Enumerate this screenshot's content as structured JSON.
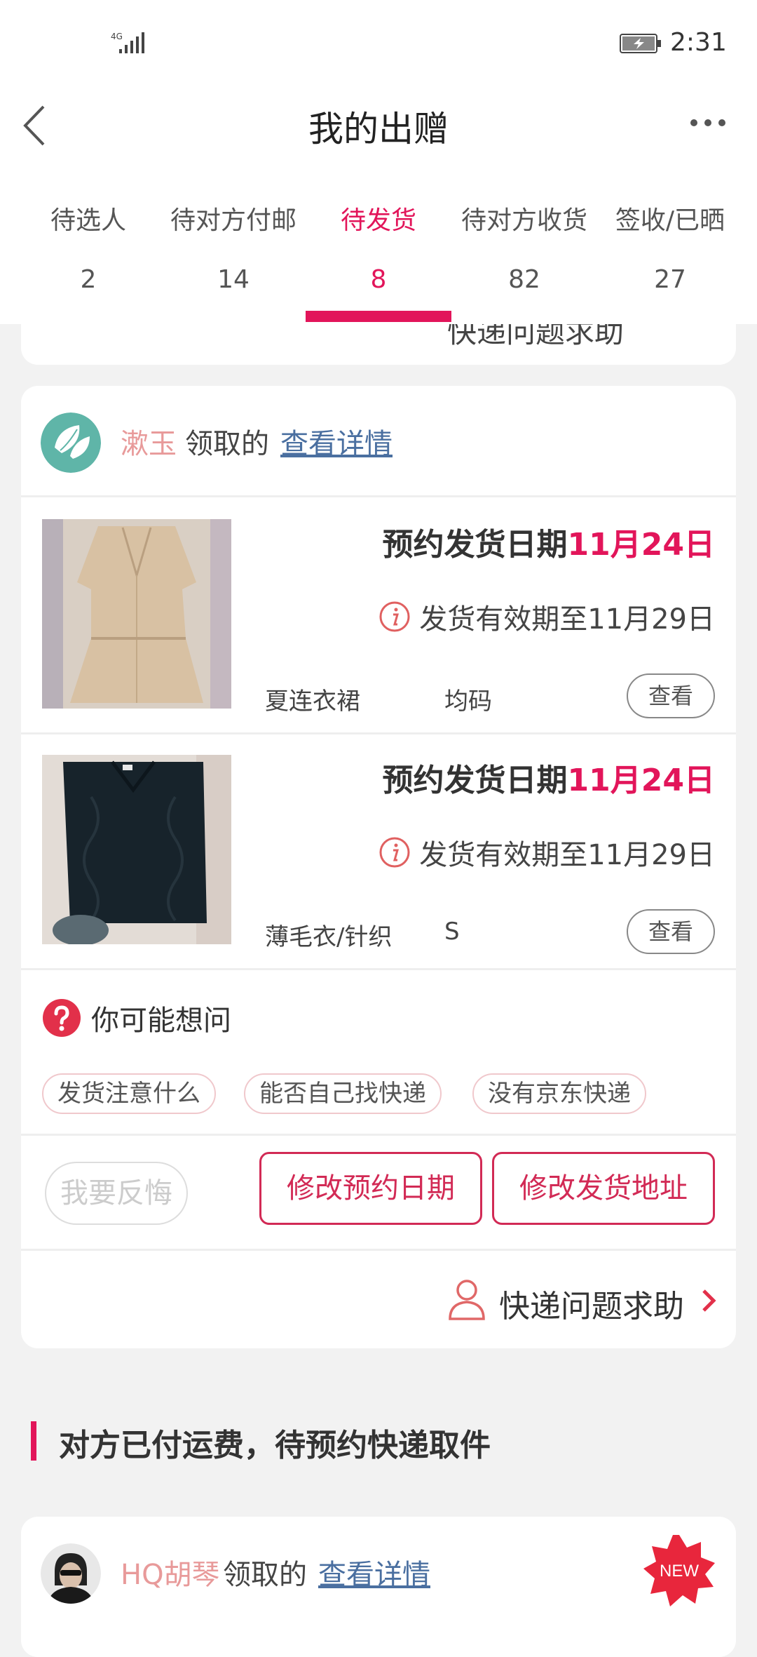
{
  "status_bar": {
    "network": "4G",
    "time": "2:31"
  },
  "nav": {
    "title": "我的出赠"
  },
  "tabs": [
    {
      "label": "待选人",
      "count": "2"
    },
    {
      "label": "待对方付邮",
      "count": "14"
    },
    {
      "label": "待发货",
      "count": "8"
    },
    {
      "label": "待对方收货",
      "count": "82"
    },
    {
      "label": "签收/已晒",
      "count": "27"
    }
  ],
  "active_tab": "待发货",
  "prev_card": {
    "help_text": "快递问题求助"
  },
  "order": {
    "recipient": "漱玉",
    "received_text": "领取的",
    "details_link": "查看详情",
    "items": [
      {
        "ship_label": "预约发货日期",
        "ship_date": "11月24日",
        "validity": "发货有效期至11月29日",
        "category": "夏连衣裙",
        "size": "均码",
        "view_label": "查看"
      },
      {
        "ship_label": "预约发货日期",
        "ship_date": "11月24日",
        "validity": "发货有效期至11月29日",
        "category": "薄毛衣/针织",
        "size": "S",
        "view_label": "查看"
      }
    ],
    "faq": {
      "title": "你可能想问",
      "chips": [
        "发货注意什么",
        "能否自己找快递",
        "没有京东快递"
      ]
    },
    "actions": {
      "regret": "我要反悔",
      "change_date": "修改预约日期",
      "change_address": "修改发货地址"
    },
    "help": "快递问题求助"
  },
  "section": {
    "title": "对方已付运费，待预约快递取件"
  },
  "next_order": {
    "recipient": "HQ胡琴",
    "received_text": "领取的",
    "details_link": "查看详情",
    "badge": "NEW"
  },
  "colors": {
    "accent": "#e2155a",
    "recipient_name": "#e89a9a",
    "link": "#4a6fa0",
    "button_border": "#d22a55"
  }
}
